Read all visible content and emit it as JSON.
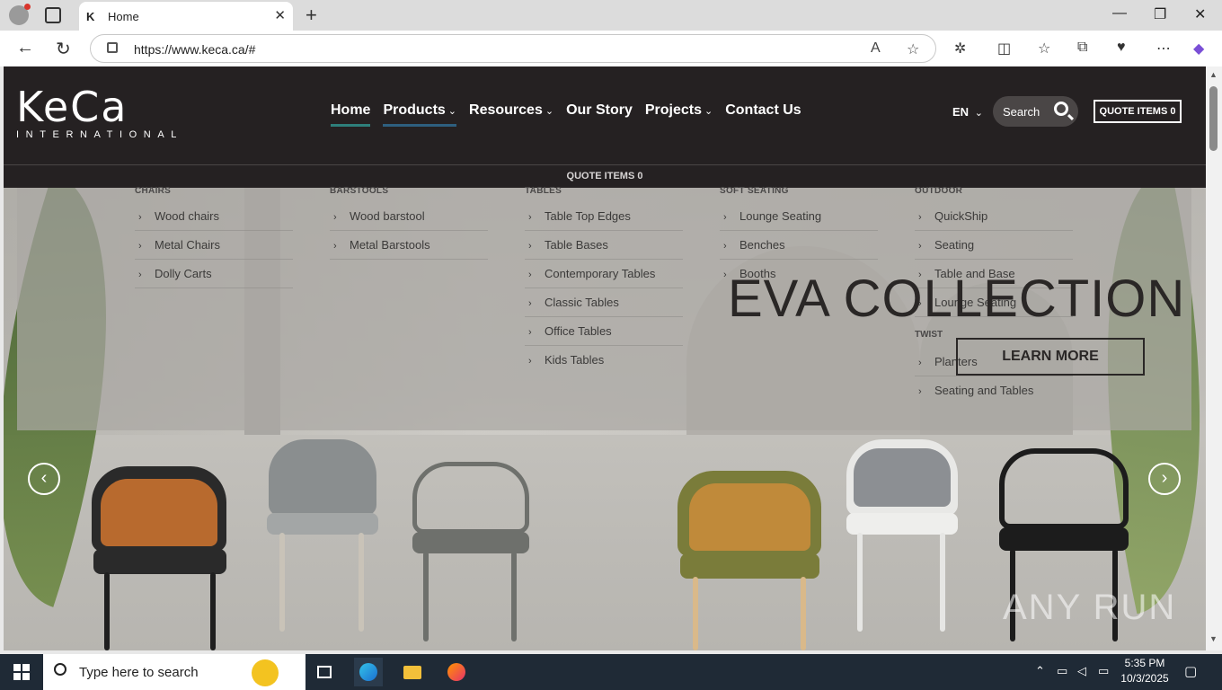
{
  "browser": {
    "tab_title": "Home",
    "tab_favicon": "K",
    "url": "https://www.keca.ca/#",
    "new_tab": "+",
    "minimize": "—",
    "maximize": "❐",
    "close": "✕"
  },
  "site": {
    "logo_word": "KeCa",
    "logo_sub": "INTERNATIONAL",
    "nav": [
      {
        "label": "Home"
      },
      {
        "label": "Products"
      },
      {
        "label": "Resources"
      },
      {
        "label": "Our Story"
      },
      {
        "label": "Projects"
      },
      {
        "label": "Contact Us"
      }
    ],
    "lang": "EN",
    "search_label": "Search",
    "quote_button": "QUOTE ITEMS 0",
    "quote_strip": "QUOTE ITEMS 0"
  },
  "megamenu": {
    "columns": [
      {
        "heading": "CHAIRS",
        "items": [
          "Wood chairs",
          "Metal Chairs",
          "Dolly Carts"
        ]
      },
      {
        "heading": "BARSTOOLS",
        "items": [
          "Wood barstool",
          "Metal Barstools"
        ]
      },
      {
        "heading": "TABLES",
        "items": [
          "Table Top Edges",
          "Table Bases",
          "Contemporary Tables",
          "Classic Tables",
          "Office Tables",
          "Kids Tables"
        ]
      },
      {
        "heading": "SOFT SEATING",
        "items": [
          "Lounge Seating",
          "Benches",
          "Booths"
        ]
      },
      {
        "heading": "OUTDOOR",
        "items": [
          "QuickShip",
          "Seating",
          "Table and Base",
          "Lounge Seating"
        ],
        "sub_heading": "TWIST",
        "sub_items": [
          "Planters",
          "Seating and Tables"
        ]
      }
    ]
  },
  "hero": {
    "title": "EVA COLLECTION",
    "cta": "LEARN MORE",
    "prev": "‹",
    "next": "›",
    "watermark": "ANY RUN"
  },
  "taskbar": {
    "search_placeholder": "Type here to search",
    "time": "5:35 PM",
    "date": "10/3/2025"
  }
}
